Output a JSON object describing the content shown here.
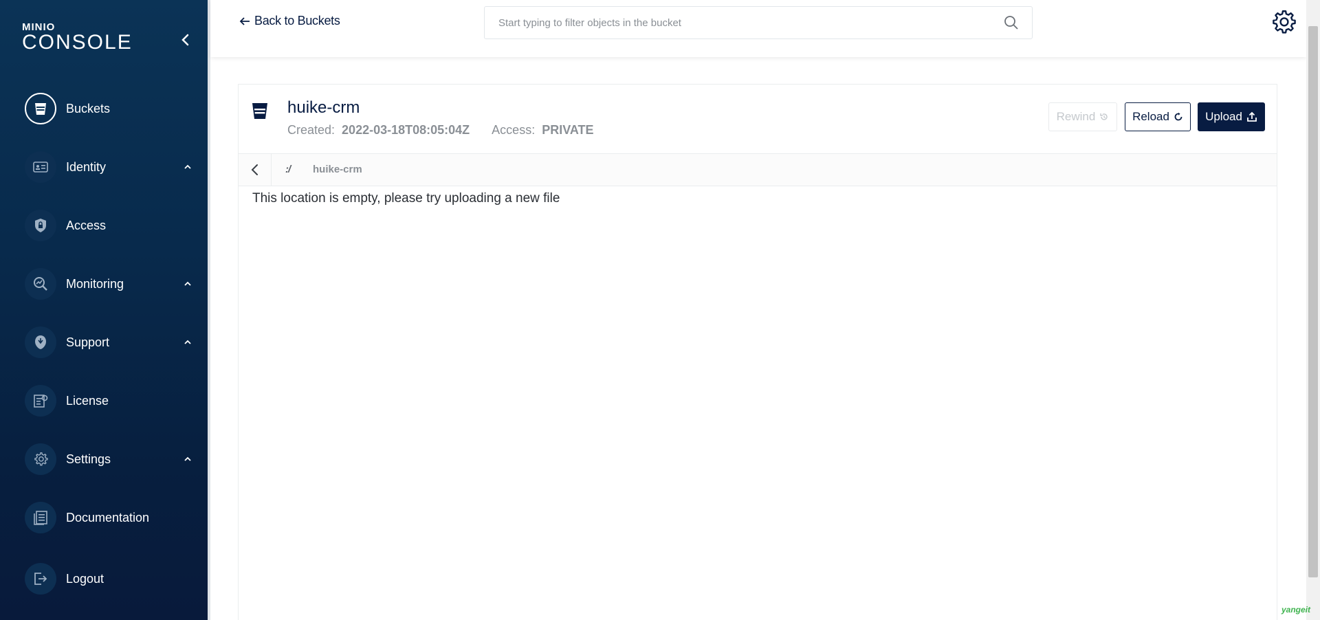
{
  "sidebar": {
    "logo_top": "MINIO",
    "logo_main": "CONSOLE",
    "items": [
      {
        "label": "Buckets",
        "icon": "bucket-icon",
        "active": true,
        "expandable": false
      },
      {
        "label": "Identity",
        "icon": "id-card-icon",
        "active": false,
        "expandable": true
      },
      {
        "label": "Access",
        "icon": "shield-lock-icon",
        "active": false,
        "expandable": false
      },
      {
        "label": "Monitoring",
        "icon": "magnifier-chart-icon",
        "active": false,
        "expandable": true
      },
      {
        "label": "Support",
        "icon": "lifebuoy-icon",
        "active": false,
        "expandable": true
      },
      {
        "label": "License",
        "icon": "license-icon",
        "active": false,
        "expandable": false
      },
      {
        "label": "Settings",
        "icon": "gear-icon",
        "active": false,
        "expandable": true
      },
      {
        "label": "Documentation",
        "icon": "document-icon",
        "active": false,
        "expandable": false
      },
      {
        "label": "Logout",
        "icon": "logout-icon",
        "active": false,
        "expandable": false
      }
    ]
  },
  "topbar": {
    "back_label": "Back to Buckets",
    "search_placeholder": "Start typing to filter objects in the bucket"
  },
  "bucket": {
    "name": "huike-crm",
    "created_label": "Created:",
    "created_value": "2022-03-18T08:05:04Z",
    "access_label": "Access:",
    "access_value": "PRIVATE"
  },
  "actions": {
    "rewind_label": "Rewind",
    "reload_label": "Reload",
    "upload_label": "Upload"
  },
  "breadcrumb": {
    "root_symbol": ":/",
    "path_label": "huike-crm"
  },
  "content": {
    "empty_message": "This location is empty, please try uploading a new file"
  },
  "watermark": "yangeit",
  "colors": {
    "sidebar_bg": "#0b3356",
    "primary": "#081c42",
    "muted_text": "#8a8f95",
    "disabled": "#c5c9cd"
  }
}
